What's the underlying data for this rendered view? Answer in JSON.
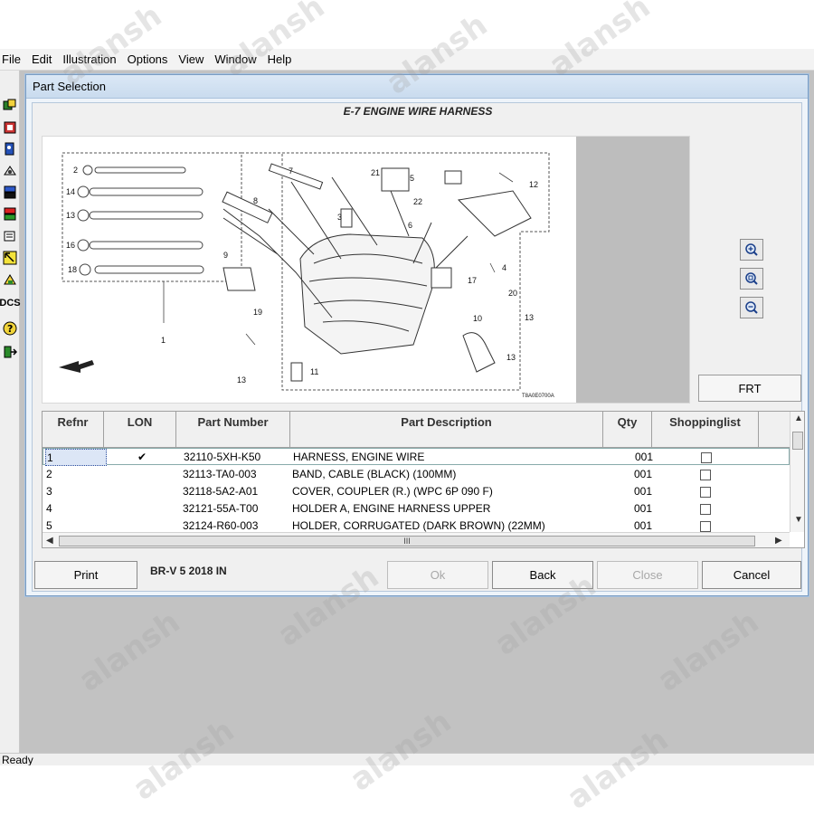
{
  "menu": [
    "File",
    "Edit",
    "Illustration",
    "Options",
    "View",
    "Window",
    "Help"
  ],
  "toolbar_icons": [
    "parts-icon",
    "catalog-icon",
    "search-icon",
    "vin-icon",
    "print-list-icon",
    "cart-icon",
    "notes-icon",
    "arrow-icon",
    "tools-icon",
    "dcs-icon",
    "help-icon",
    "exit-icon"
  ],
  "toolbar_dcs_label": "DCS",
  "dialog": {
    "title": "Part Selection",
    "drawing_title": "E-7 ENGINE WIRE HARNESS",
    "illustration_code": "T8A0E0700A",
    "callouts": [
      "2",
      "14",
      "13",
      "16",
      "18",
      "7",
      "8",
      "3",
      "21",
      "5",
      "22",
      "12",
      "6",
      "4",
      "17",
      "20",
      "9",
      "19",
      "10",
      "13",
      "13",
      "1",
      "11",
      "13"
    ],
    "frt_label": "FRT",
    "zoom_icons": [
      "zoom-in-icon",
      "zoom-fit-icon",
      "zoom-out-icon"
    ]
  },
  "grid": {
    "columns": [
      "Refnr",
      "LON",
      "Part Number",
      "Part Description",
      "Qty",
      "Shoppinglist"
    ],
    "rows": [
      {
        "ref": "1",
        "lon": "✔",
        "part": "32110-5XH-K50",
        "desc": "HARNESS, ENGINE WIRE",
        "qty": "001",
        "shop": false
      },
      {
        "ref": "2",
        "lon": "",
        "part": "32113-TA0-003",
        "desc": "BAND, CABLE (BLACK) (100MM)",
        "qty": "001",
        "shop": false
      },
      {
        "ref": "3",
        "lon": "",
        "part": "32118-5A2-A01",
        "desc": "COVER, COUPLER (R.) (WPC 6P 090 F)",
        "qty": "001",
        "shop": false
      },
      {
        "ref": "4",
        "lon": "",
        "part": "32121-55A-T00",
        "desc": "HOLDER A, ENGINE HARNESS UPPER",
        "qty": "001",
        "shop": false
      },
      {
        "ref": "5",
        "lon": "",
        "part": "32124-R60-003",
        "desc": "HOLDER, CORRUGATED (DARK BROWN) (22MM)",
        "qty": "001",
        "shop": false
      }
    ],
    "hscroll_label": "III"
  },
  "buttons": {
    "print": "Print",
    "ok": "Ok",
    "back": "Back",
    "close": "Close",
    "cancel": "Cancel"
  },
  "vehicle": "BR-V  5  2018  IN",
  "status": "Ready",
  "watermark": "alansh"
}
